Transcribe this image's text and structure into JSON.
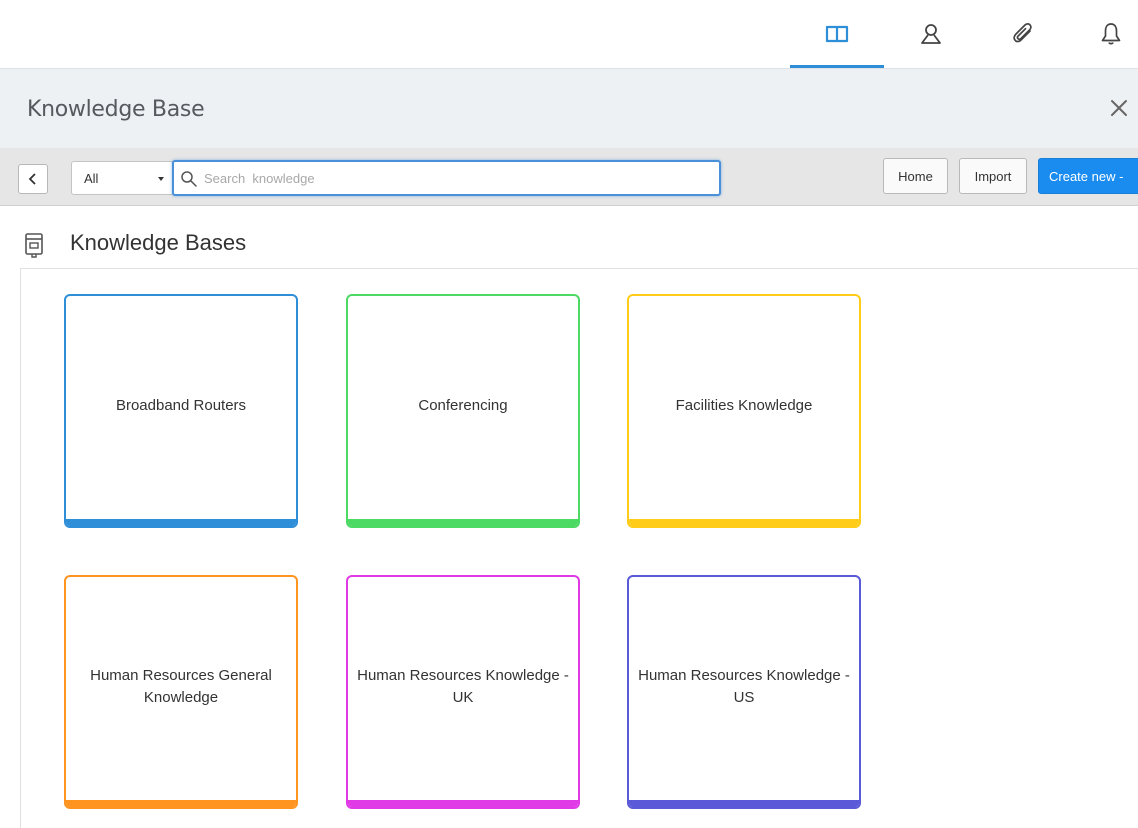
{
  "topbar": {
    "icons": [
      "book-icon",
      "user-icon",
      "paperclip-icon",
      "bell-icon"
    ],
    "active_color": "#2e8fd8"
  },
  "panel": {
    "title": "Knowledge Base",
    "close_icon": "close-icon"
  },
  "toolbar": {
    "filter_value": "All",
    "search_placeholder": "Search  knowledge",
    "home_label": "Home",
    "import_label": "Import",
    "create_label": "Create new -",
    "create_color": "#1a8cf0"
  },
  "section": {
    "title": "Knowledge Bases",
    "icon": "knowledge-base-icon"
  },
  "cards": [
    {
      "label": "Broadband Routers",
      "color": "#2e8fd8"
    },
    {
      "label": "Conferencing",
      "color": "#4cd964"
    },
    {
      "label": "Facilities Knowledge",
      "color": "#ffcc1a"
    },
    {
      "label": "Human Resources General Knowledge",
      "color": "#ff9420"
    },
    {
      "label": "Human Resources Knowledge - UK",
      "color": "#e03ae6"
    },
    {
      "label": "Human Resources Knowledge - US",
      "color": "#5a5ad8"
    }
  ]
}
